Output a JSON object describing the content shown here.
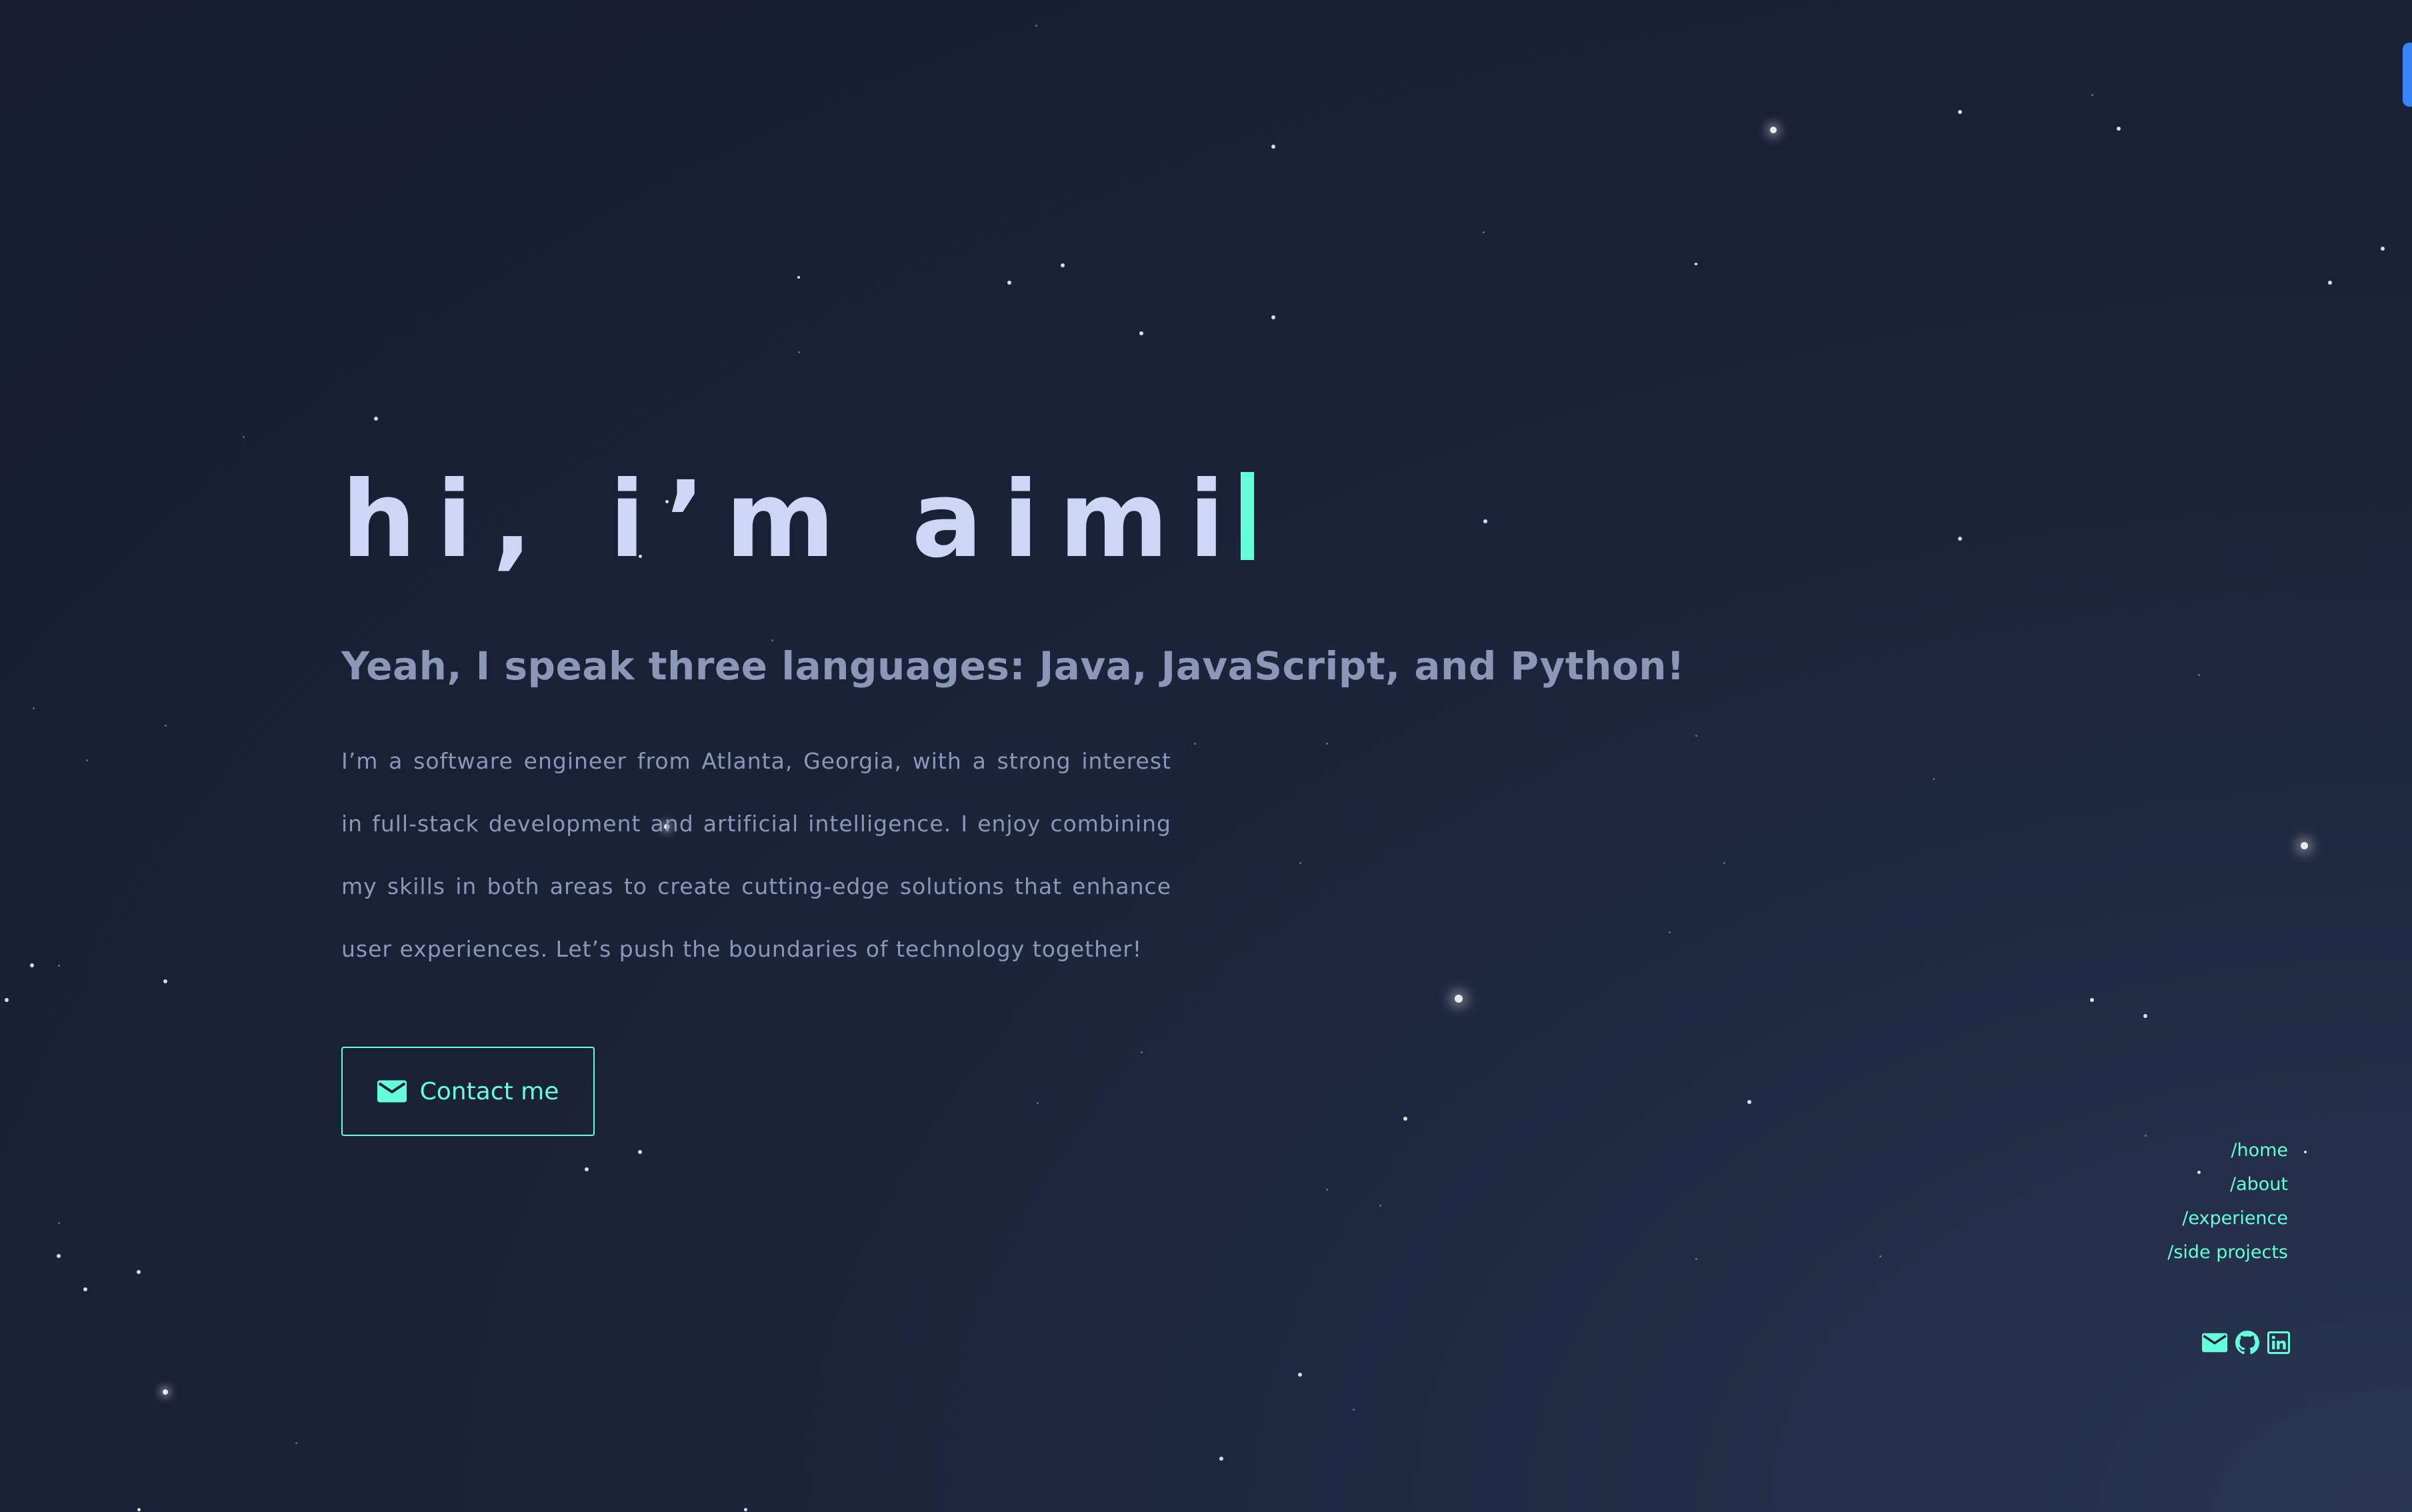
{
  "hero": {
    "title": "hi, i’m aimi",
    "title_caret_char": "l",
    "subtitle": "Yeah, I speak three languages: Java, JavaScript, and Python!",
    "body": "I’m a software engineer from Atlanta, Georgia, with a strong interest in full-stack development and artificial intelligence. I enjoy combining my skills in both areas to create cutting-edge solutions that enhance user experiences. Let’s push the boundaries of technology together!",
    "contact_button": {
      "label": "Contact me",
      "icon": "mail-icon"
    }
  },
  "side_nav": {
    "items": [
      {
        "label": "/home"
      },
      {
        "label": "/about"
      },
      {
        "label": "/experience"
      },
      {
        "label": "/side projects"
      }
    ]
  },
  "social": {
    "icons": [
      "mail-icon",
      "github-icon",
      "linkedin-icon"
    ]
  },
  "colors": {
    "accent": "#64ffda",
    "title": "#cdd6f5",
    "text": "#8c97b8",
    "background": "#1a2136",
    "corner_tab": "#3b82f6"
  }
}
